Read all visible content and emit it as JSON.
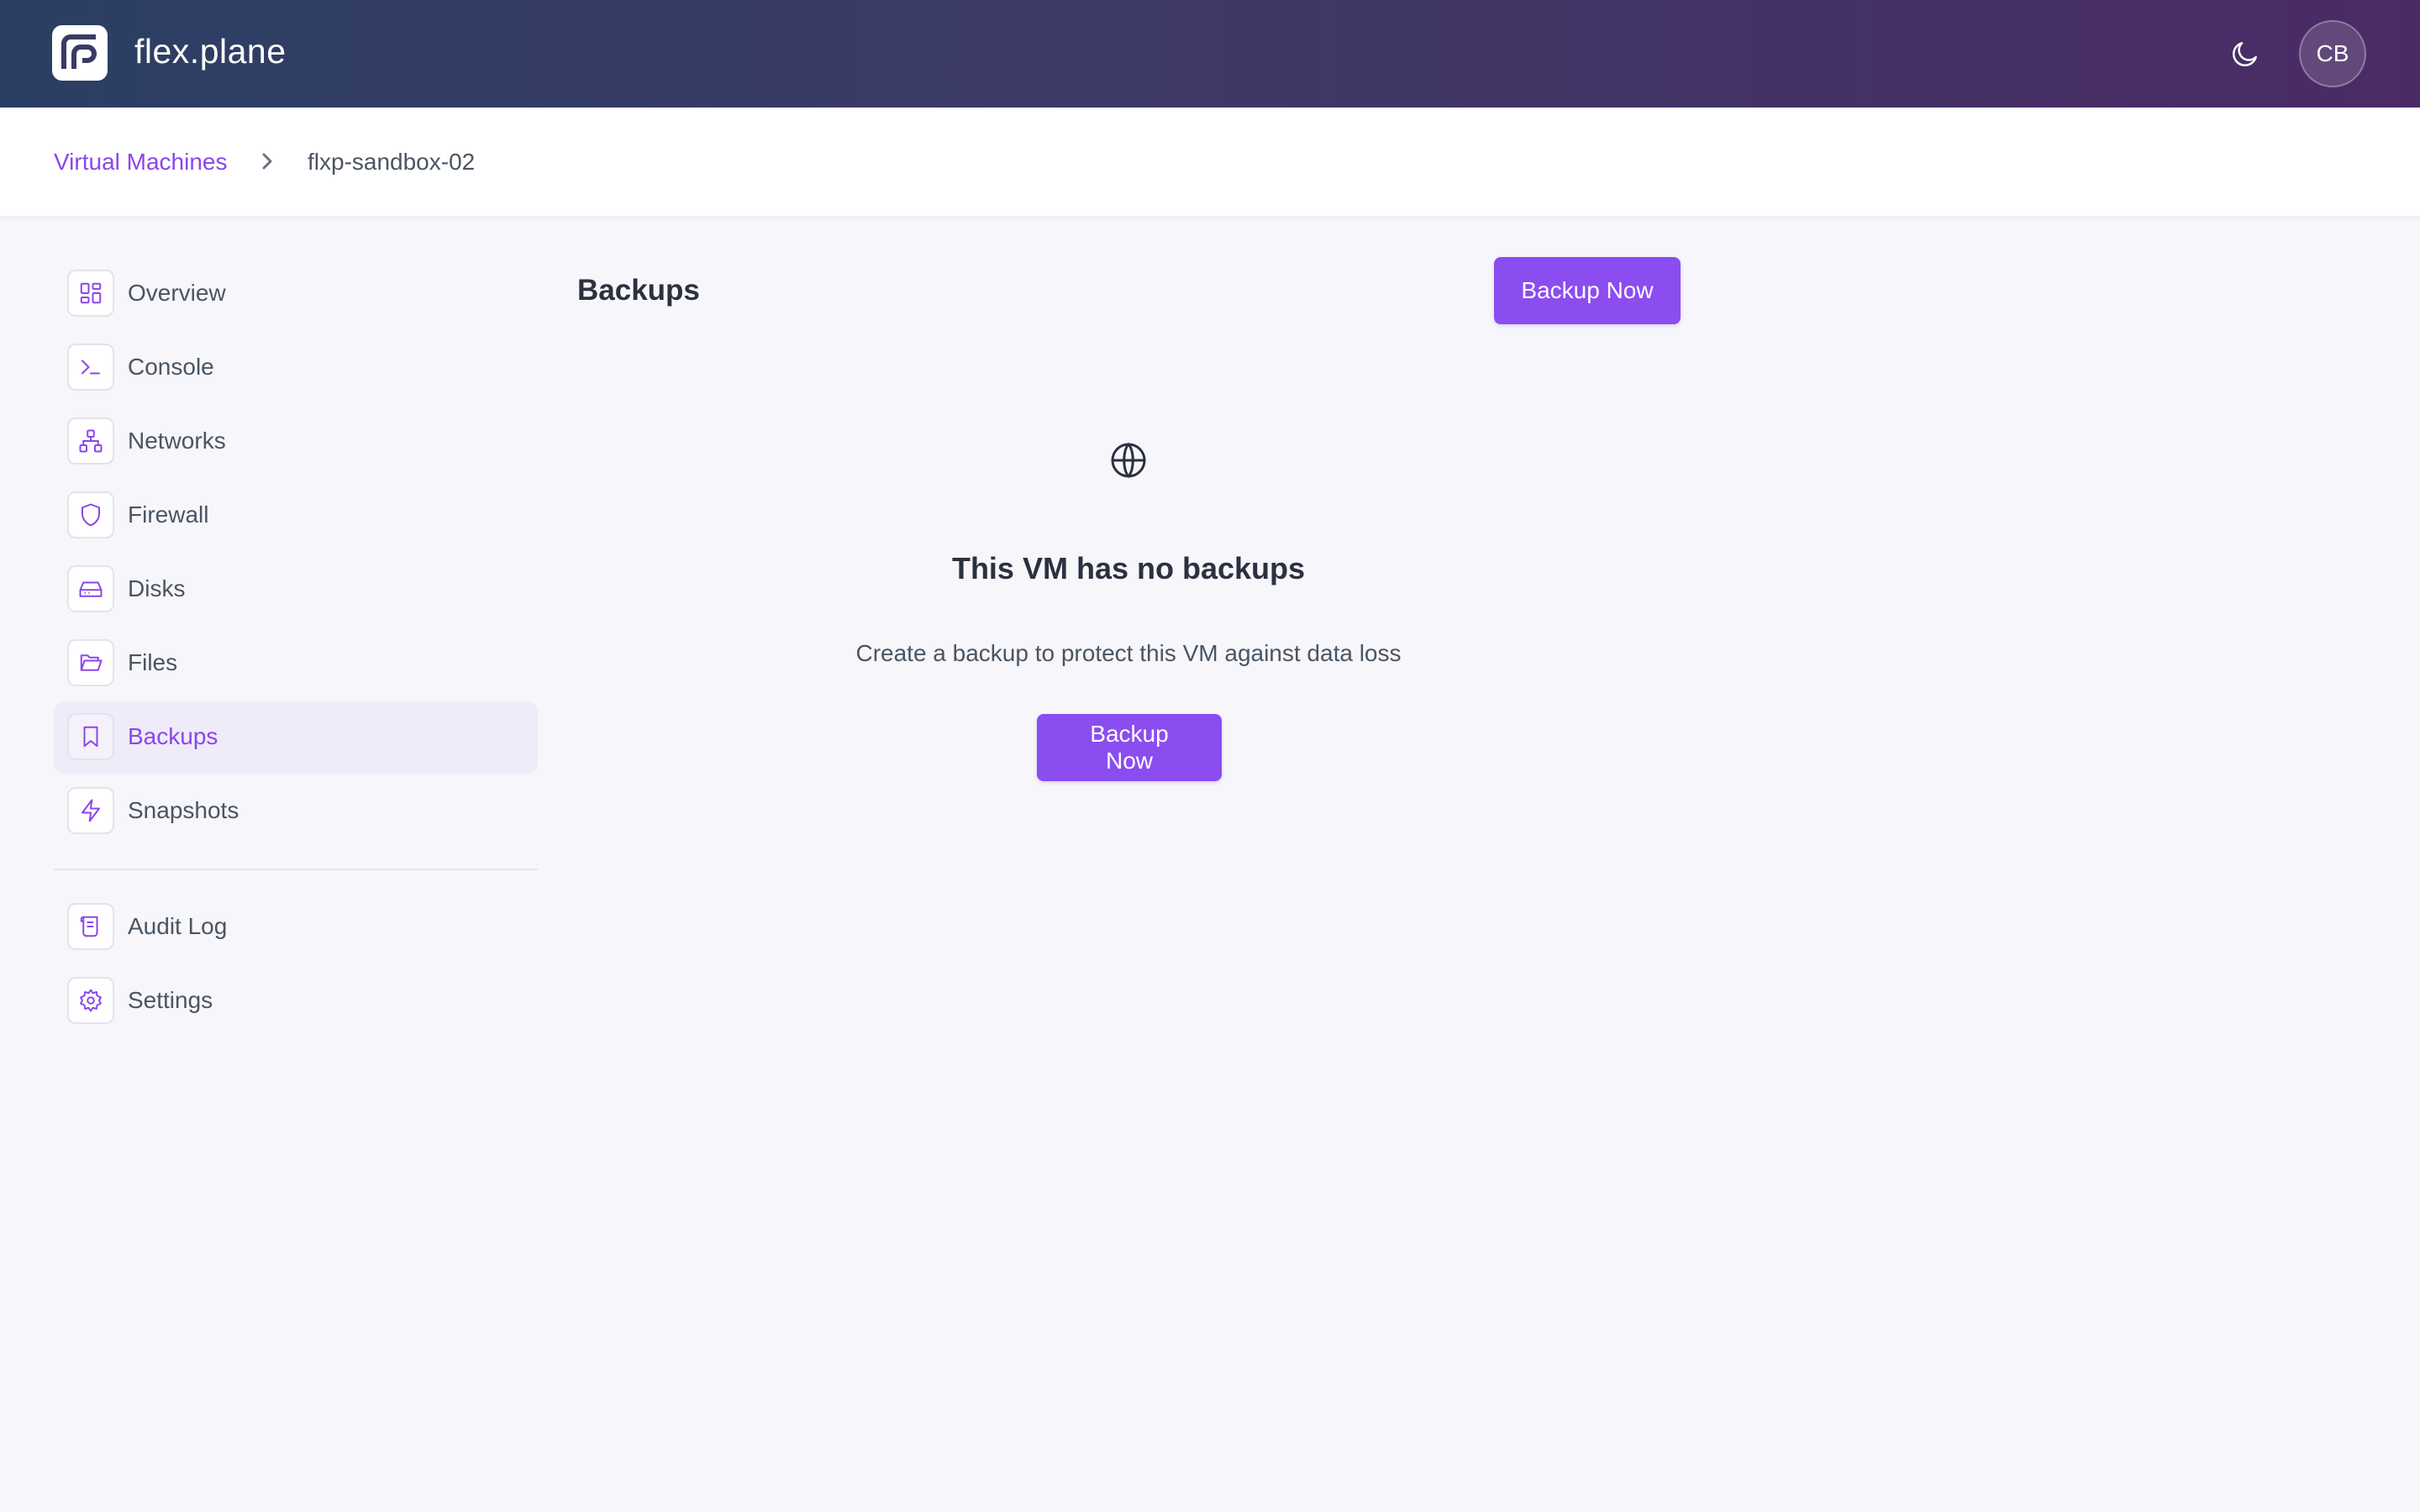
{
  "header": {
    "brand": "flex.plane",
    "avatar_initials": "CB",
    "theme_toggle_icon": "moon-icon"
  },
  "breadcrumb": {
    "parent": "Virtual Machines",
    "current": "flxp-sandbox-02"
  },
  "sidebar": {
    "items": [
      {
        "label": "Overview",
        "icon": "dashboard-grid-icon"
      },
      {
        "label": "Console",
        "icon": "terminal-icon"
      },
      {
        "label": "Networks",
        "icon": "network-icon"
      },
      {
        "label": "Firewall",
        "icon": "shield-icon"
      },
      {
        "label": "Disks",
        "icon": "hard-drive-icon"
      },
      {
        "label": "Files",
        "icon": "folder-open-icon"
      },
      {
        "label": "Backups",
        "icon": "bookmark-icon",
        "active": true
      },
      {
        "label": "Snapshots",
        "icon": "lightning-icon"
      }
    ],
    "secondary_items": [
      {
        "label": "Audit Log",
        "icon": "scroll-icon"
      },
      {
        "label": "Settings",
        "icon": "gear-icon"
      }
    ]
  },
  "main": {
    "title": "Backups",
    "primary_action": "Backup Now",
    "empty_state": {
      "icon": "globe-icon",
      "title": "This VM has no backups",
      "description": "Create a backup to protect this VM against data loss",
      "action": "Backup Now"
    }
  },
  "colors": {
    "accent": "#8b4cf0",
    "header_gradient_start": "#2b3f63",
    "header_gradient_end": "#4a2b66",
    "page_background": "#f6f6fb"
  }
}
